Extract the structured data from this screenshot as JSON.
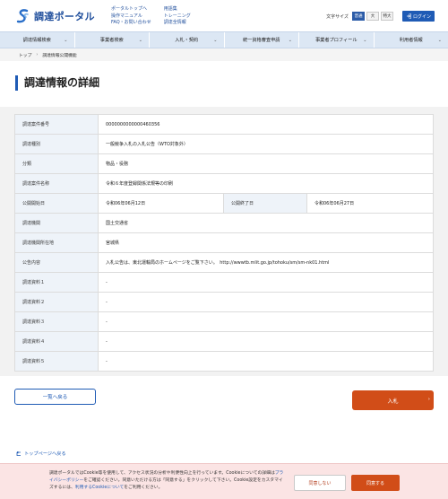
{
  "header": {
    "logo_text": "調達ポータル",
    "links_col1": [
      "ポータルトップへ",
      "操作マニュアル",
      "FAQ・お問い合わせ"
    ],
    "links_col2": [
      "用語集",
      "トレーニング",
      "調達全情報"
    ],
    "font_size_label": "文字サイズ",
    "font_sizes": [
      "普通",
      "大",
      "特大"
    ],
    "login_label": "ログイン",
    "brand_color": "#1f4e9c",
    "accent_color": "#1f5bb5"
  },
  "gnav": [
    "調達情報検索",
    "事業者検索",
    "入札・契約",
    "統一資格審査申請",
    "事業者プロフィール",
    "利用者情報"
  ],
  "breadcrumb": [
    "トップ",
    "調達情報公開機能"
  ],
  "page_title": "調達情報の詳細",
  "details": {
    "case_number_label": "調達案件番号",
    "case_number": "0000000000000460356",
    "type_label": "調達種別",
    "type": "一般競争入札の入札公告（WTO対象外）",
    "category_label": "分類",
    "category": "物品・役務",
    "name_label": "調達案件名称",
    "name": "令和６年度登録関係法規等の印刷",
    "start_label": "公開開始日",
    "start": "令和06年06月12日",
    "end_label": "公開終了日",
    "end": "令和06年06月27日",
    "agency_label": "調達機関",
    "agency": "国土交通省",
    "location_label": "調達機関所在地",
    "location": "宮城県",
    "notice_label": "公告内容",
    "notice": "入札公告は、東北運輸局のホームページをご覧下さい。　http://wwwtb.mlit.go.jp/tohoku/sm/sm-nk01.html",
    "material1_label": "調達資料１",
    "material1": "-",
    "material2_label": "調達資料２",
    "material2": "-",
    "material3_label": "調達資料３",
    "material3": "-",
    "material4_label": "調達資料４",
    "material4": "-",
    "material5_label": "調達資料５",
    "material5": "-"
  },
  "buttons": {
    "back_to_list": "一覧へ戻る",
    "bid": "入札",
    "to_top": "トップページへ戻る"
  },
  "cookie": {
    "text_1": "調達ポータルではCookie等を使用して、アクセス状況の分析や利便性向上を行っています。Cookieについての詳細は",
    "privacy_link": "プライバシーポリシー",
    "text_2": "をご確認ください。同意いただける方は「同意する」をクリックして下さい。Cookie設定をカスタマイズするには、",
    "cookie_link": "利用するCookieについて",
    "text_3": "をご利用ください。",
    "deny": "同意しない",
    "agree": "同意する"
  }
}
